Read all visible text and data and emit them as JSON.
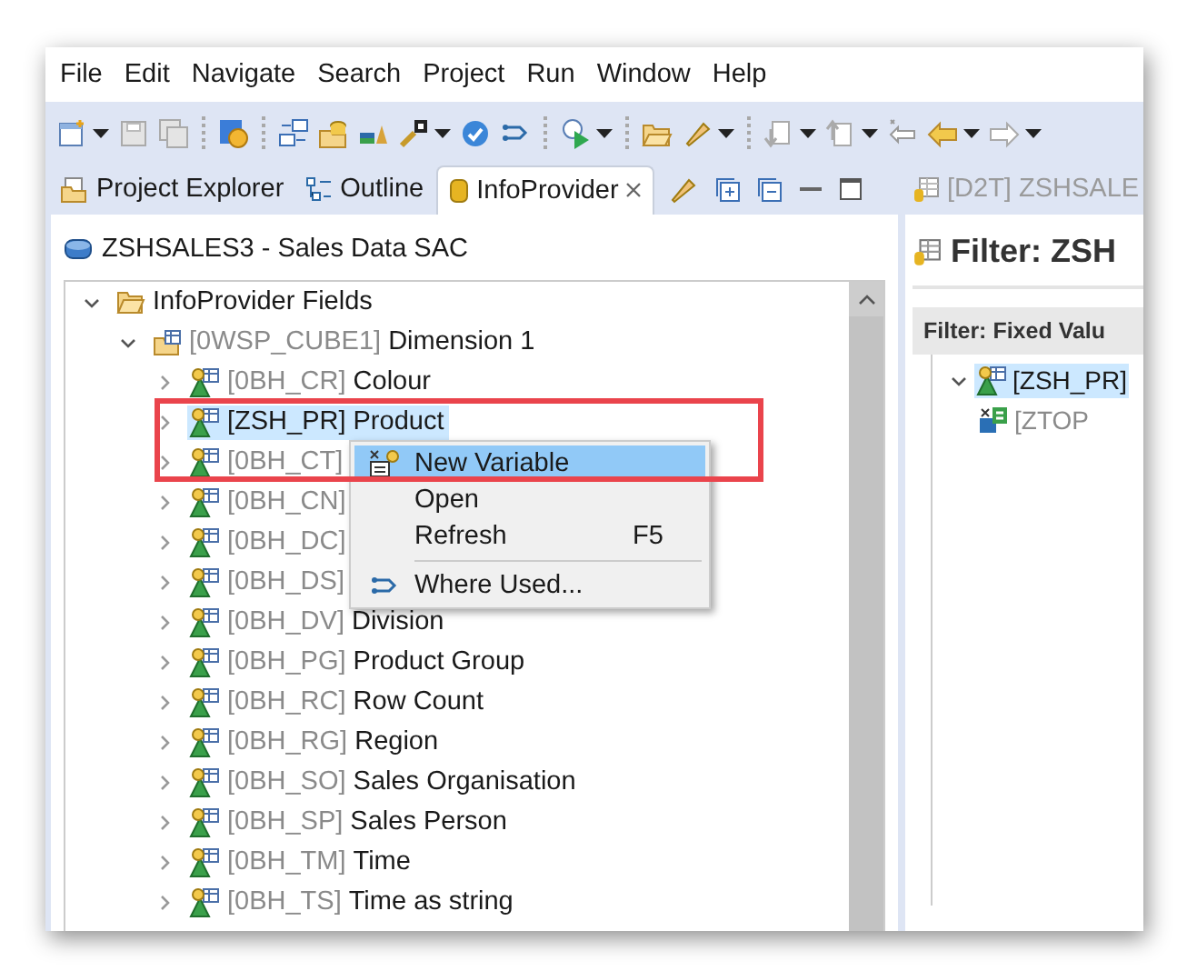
{
  "menu": [
    "File",
    "Edit",
    "Navigate",
    "Search",
    "Project",
    "Run",
    "Window",
    "Help"
  ],
  "left_tabs": [
    {
      "label": "Project Explorer",
      "kind": "project",
      "selected": false
    },
    {
      "label": "Outline",
      "kind": "outline",
      "selected": false
    },
    {
      "label": "InfoProvider",
      "kind": "infoprovider",
      "selected": true
    }
  ],
  "provider_title": "ZSHSALES3 - Sales Data SAC",
  "tree": [
    {
      "kind": "folder",
      "label": "InfoProvider Fields",
      "expanded": true,
      "selected": false,
      "children": [
        {
          "kind": "dimension",
          "code": "[0WSP_CUBE1]",
          "label": "Dimension 1",
          "expanded": true,
          "selected": false,
          "children": [
            {
              "kind": "characteristic",
              "code": "[0BH_CR]",
              "label": "Colour",
              "expanded": false,
              "selected": false
            },
            {
              "kind": "characteristic",
              "code": "[ZSH_PR]",
              "label": "Product",
              "expanded": false,
              "selected": true
            },
            {
              "kind": "characteristic",
              "code": "[0BH_CT]",
              "expanded": false,
              "selected": false
            },
            {
              "kind": "characteristic",
              "code": "[0BH_CN]",
              "expanded": false,
              "selected": false
            },
            {
              "kind": "characteristic",
              "code": "[0BH_DC]",
              "expanded": false,
              "selected": false
            },
            {
              "kind": "characteristic",
              "code": "[0BH_DS]",
              "expanded": false,
              "selected": false
            },
            {
              "kind": "characteristic",
              "code": "[0BH_DV]",
              "label": "Division",
              "expanded": false,
              "selected": false
            },
            {
              "kind": "characteristic",
              "code": "[0BH_PG]",
              "label": "Product Group",
              "expanded": false,
              "selected": false
            },
            {
              "kind": "characteristic",
              "code": "[0BH_RC]",
              "label": "Row Count",
              "expanded": false,
              "selected": false
            },
            {
              "kind": "characteristic",
              "code": "[0BH_RG]",
              "label": "Region",
              "expanded": false,
              "selected": false
            },
            {
              "kind": "characteristic",
              "code": "[0BH_SO]",
              "label": "Sales Organisation",
              "expanded": false,
              "selected": false
            },
            {
              "kind": "characteristic",
              "code": "[0BH_SP]",
              "label": "Sales Person",
              "expanded": false,
              "selected": false
            },
            {
              "kind": "characteristic",
              "code": "[0BH_TM]",
              "label": "Time",
              "expanded": false,
              "selected": false
            },
            {
              "kind": "characteristic",
              "code": "[0BH_TS]",
              "label": "Time as string",
              "expanded": false,
              "selected": false
            }
          ]
        }
      ]
    }
  ],
  "context_menu": [
    {
      "label": "New Variable",
      "kind": "variable",
      "selected": true,
      "separator_before": false
    },
    {
      "label": "Open",
      "kind": "plain",
      "selected": false,
      "separator_before": false
    },
    {
      "label": "Refresh",
      "shortcut": "F5",
      "kind": "plain",
      "selected": false,
      "separator_before": false
    },
    {
      "label": "Where Used...",
      "kind": "where_used",
      "selected": false,
      "separator_before": true
    }
  ],
  "right_tab": "[D2T] ZSHSALE",
  "filter_heading": "Filter: ZSH",
  "filter_section": "Filter: Fixed Valu",
  "filter_tree": [
    {
      "kind": "characteristic",
      "label": "[ZSH_PR]",
      "expanded": true,
      "selected": true,
      "children": [
        {
          "kind": "variable",
          "label": "[ZTOP",
          "selected": false
        }
      ]
    }
  ]
}
